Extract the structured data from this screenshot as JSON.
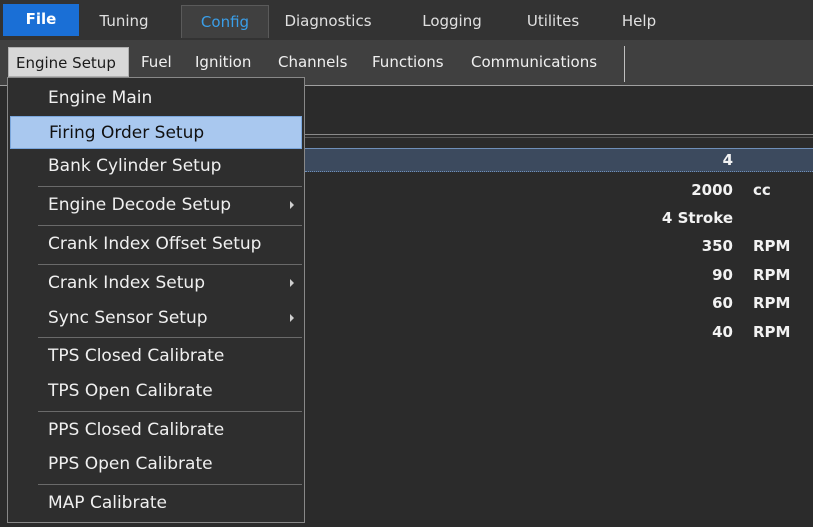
{
  "tabs": {
    "file": "File",
    "tuning": "Tuning",
    "config": "Config",
    "diagnostics": "Diagnostics",
    "logging": "Logging",
    "utilites": "Utilites",
    "help": "Help"
  },
  "subtabs": {
    "engine_setup": "Engine Setup",
    "fuel": "Fuel",
    "ignition": "Ignition",
    "channels": "Channels",
    "functions": "Functions",
    "communications": "Communications"
  },
  "menu": {
    "engine_main": "Engine Main",
    "firing_order_setup": "Firing Order Setup",
    "bank_cylinder_setup": "Bank Cylinder Setup",
    "engine_decode_setup": "Engine Decode Setup",
    "crank_index_offset_setup": "Crank Index Offset Setup",
    "crank_index_setup": "Crank Index Setup",
    "sync_sensor_setup": "Sync Sensor Setup",
    "tps_closed_calibrate": "TPS Closed Calibrate",
    "tps_open_calibrate": "TPS Open Calibrate",
    "pps_closed_calibrate": "PPS Closed Calibrate",
    "pps_open_calibrate": "PPS Open Calibrate",
    "map_calibrate": "MAP Calibrate"
  },
  "rows": [
    {
      "value": "4",
      "unit": ""
    },
    {
      "value": "2000",
      "unit": "cc"
    },
    {
      "value": "4 Stroke",
      "unit": ""
    },
    {
      "value": "350",
      "unit": "RPM"
    },
    {
      "value": "90",
      "unit": "RPM"
    },
    {
      "value": "60",
      "unit": "RPM"
    },
    {
      "value": "40",
      "unit": "RPM"
    }
  ],
  "colors": {
    "file_tab": "#1a6fd6",
    "active_tab_text": "#3a9ee8",
    "menu_hover": "#a9c8ef"
  }
}
